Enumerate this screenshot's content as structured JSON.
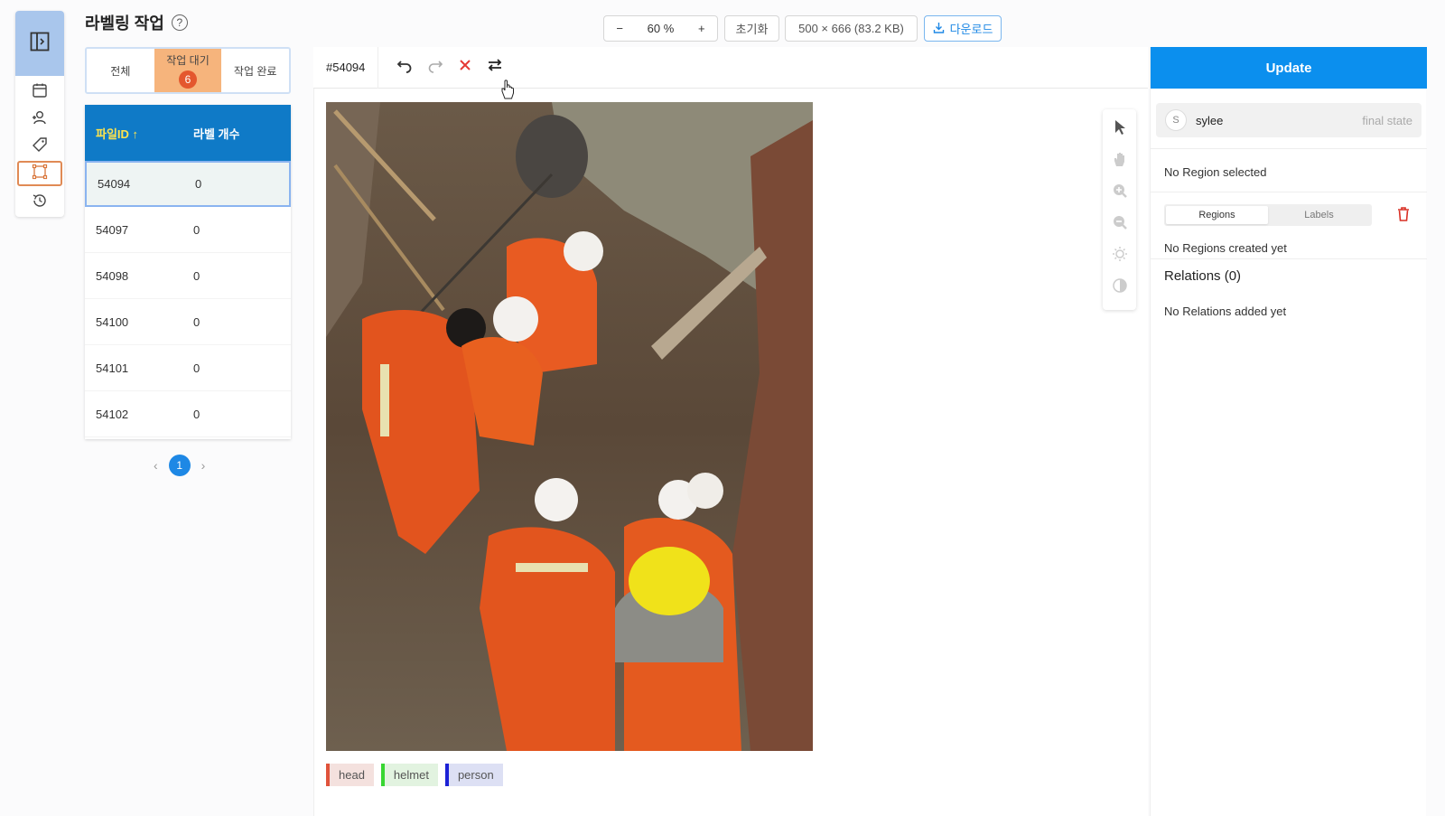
{
  "page": {
    "title": "라벨링 작업",
    "help_icon": "question-circle-icon"
  },
  "rail": {
    "items": [
      {
        "icon": "sidebar-toggle-icon"
      },
      {
        "icon": "calendar-icon"
      },
      {
        "icon": "user-add-icon"
      },
      {
        "icon": "tag-icon"
      },
      {
        "icon": "bounding-box-icon",
        "active": true
      },
      {
        "icon": "history-icon"
      }
    ]
  },
  "toolbar": {
    "zoom_out": "−",
    "zoom_value": "60 %",
    "zoom_in": "+",
    "reset_label": "초기화",
    "image_info": "500 × 666 (83.2 KB)",
    "download_label": "다운로드"
  },
  "tabs": [
    {
      "label": "전체",
      "active": false
    },
    {
      "label": "작업 대기",
      "badge": "6",
      "active": true
    },
    {
      "label": "작업 완료",
      "active": false
    }
  ],
  "file_table": {
    "headers": {
      "file_id": "파일ID ↑",
      "label_count": "라벨 개수"
    },
    "rows": [
      {
        "id": "54094",
        "count": "0",
        "selected": true
      },
      {
        "id": "54097",
        "count": "0"
      },
      {
        "id": "54098",
        "count": "0"
      },
      {
        "id": "54100",
        "count": "0"
      },
      {
        "id": "54101",
        "count": "0"
      },
      {
        "id": "54102",
        "count": "0"
      }
    ]
  },
  "pager": {
    "prev": "‹",
    "current": "1",
    "next": "›"
  },
  "editor": {
    "task_id": "#54094",
    "tools": [
      "undo-icon",
      "redo-icon",
      "delete-x-icon",
      "swap-icon"
    ]
  },
  "side_tools": [
    "pointer-icon",
    "hand-icon",
    "zoom-in-icon",
    "zoom-out-icon",
    "brightness-icon",
    "contrast-icon"
  ],
  "labels": [
    {
      "name": "head",
      "color": "#e0533b",
      "bg": "#f4e1de"
    },
    {
      "name": "helmet",
      "color": "#38d632",
      "bg": "#e2f3e0"
    },
    {
      "name": "person",
      "color": "#1c22d6",
      "bg": "#dde0f4"
    }
  ],
  "right_panel": {
    "update_label": "Update",
    "user_initial": "S",
    "user_name": "sylee",
    "user_state": "final state",
    "no_region": "No Region selected",
    "seg_regions": "Regions",
    "seg_labels": "Labels",
    "no_regions": "No Regions created yet",
    "relations_title": "Relations (0)",
    "no_relations": "No Relations added yet"
  },
  "colors": {
    "accent": "#0b8fee",
    "tab_active": "#f6b47c",
    "badge": "#e4572e",
    "table_header": "#0f7ac7"
  }
}
